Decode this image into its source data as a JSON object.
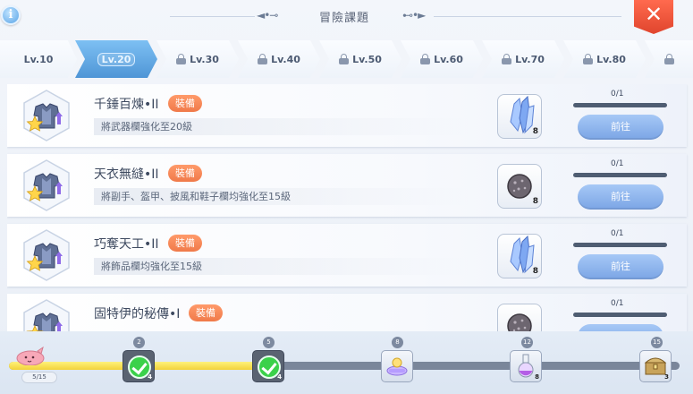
{
  "header": {
    "title": "冒險課題",
    "info_label": "i",
    "close_label": "✕"
  },
  "tabs": [
    {
      "label": "Lv.10",
      "locked": false,
      "active": false
    },
    {
      "label": "Lv.20",
      "locked": false,
      "active": true
    },
    {
      "label": "Lv.30",
      "locked": true,
      "active": false
    },
    {
      "label": "Lv.40",
      "locked": true,
      "active": false
    },
    {
      "label": "Lv.50",
      "locked": true,
      "active": false
    },
    {
      "label": "Lv.60",
      "locked": true,
      "active": false
    },
    {
      "label": "Lv.70",
      "locked": true,
      "active": false
    },
    {
      "label": "Lv.80",
      "locked": true,
      "active": false
    }
  ],
  "quests": [
    {
      "name": "千錘百煉•II",
      "tag": "裝備",
      "desc": "將武器欄強化至20級",
      "reward_icon": "crystal-icon",
      "reward_count": "8",
      "progress": "0/1",
      "progress_fraction": 0,
      "button": "前往"
    },
    {
      "name": "天衣無縫•II",
      "tag": "裝備",
      "desc": "將副手、盔甲、披風和鞋子欄均強化至15級",
      "reward_icon": "ore-icon",
      "reward_count": "8",
      "progress": "0/1",
      "progress_fraction": 0,
      "button": "前往"
    },
    {
      "name": "巧奪天工•II",
      "tag": "裝備",
      "desc": "將飾品欄均強化至15級",
      "reward_icon": "crystal-icon",
      "reward_count": "8",
      "progress": "0/1",
      "progress_fraction": 0,
      "button": "前往"
    },
    {
      "name": "固特伊的秘傳•I",
      "tag": "裝備",
      "desc": "",
      "reward_icon": "ore-icon",
      "reward_count": "",
      "progress": "0/1",
      "progress_fraction": 0,
      "button": ""
    }
  ],
  "milestones": {
    "counter": "5/15",
    "fill_fraction": 0.38,
    "items": [
      {
        "num": "2",
        "count": "4",
        "done": true,
        "icon": "check-icon"
      },
      {
        "num": "5",
        "count": "4",
        "done": true,
        "icon": "check-icon"
      },
      {
        "num": "8",
        "count": "",
        "done": false,
        "icon": "zeny-icon"
      },
      {
        "num": "12",
        "count": "8",
        "done": false,
        "icon": "potion-icon"
      },
      {
        "num": "15",
        "count": "3",
        "done": false,
        "icon": "chest-icon"
      }
    ]
  },
  "colors": {
    "active_tab": "#5aa0dd",
    "tag": "#f4834f",
    "button": "#8ab2ea",
    "check": "#3bd14a",
    "track_fill": "#f2d23a",
    "close": "#e8503a"
  }
}
